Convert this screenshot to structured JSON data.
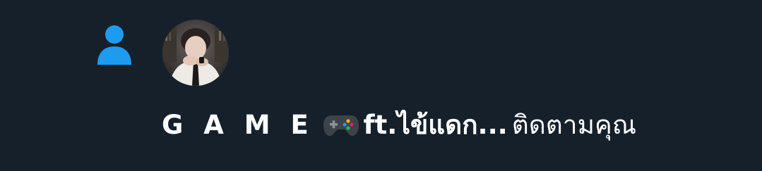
{
  "notification": {
    "icon": "person-icon",
    "accent_color": "#1d9bf0",
    "background_color": "#15202b",
    "user": {
      "name_spaced": "G A M E",
      "emoji": "video-game-controller",
      "name_rest": "ft.ไข้แดก...",
      "avatar": "user-avatar-photo"
    },
    "action_text": "ติดตามคุณ"
  }
}
